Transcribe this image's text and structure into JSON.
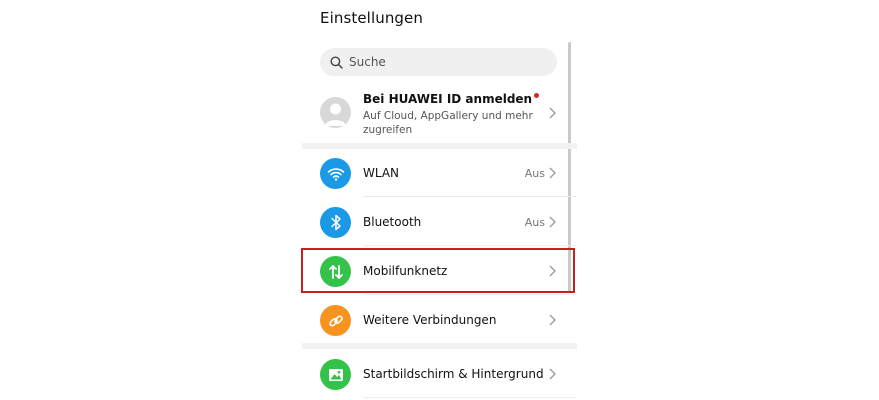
{
  "header": {
    "title": "Einstellungen"
  },
  "search": {
    "placeholder": "Suche",
    "icon": "search-icon"
  },
  "account": {
    "title": "Bei HUAWEI ID anmelden",
    "subtitle": "Auf Cloud, AppGallery und mehr zugreifen",
    "dot_color": "#e0271f"
  },
  "settings": [
    {
      "label": "WLAN",
      "value": "Aus",
      "icon": "wifi-icon",
      "color": "#1a9ae6"
    },
    {
      "label": "Bluetooth",
      "value": "Aus",
      "icon": "bluetooth-icon",
      "color": "#1a9ae6"
    },
    {
      "label": "Mobilfunknetz",
      "value": "",
      "icon": "mobile-data-icon",
      "color": "#35c24a"
    },
    {
      "label": "Weitere Verbindungen",
      "value": "",
      "icon": "link-icon",
      "color": "#f7931e"
    },
    {
      "label": "Startbildschirm & Hintergrund",
      "value": "",
      "icon": "image-icon",
      "color": "#35c24a"
    }
  ],
  "highlight": {
    "target": "Mobilfunknetz",
    "color": "#cc1e1e"
  }
}
